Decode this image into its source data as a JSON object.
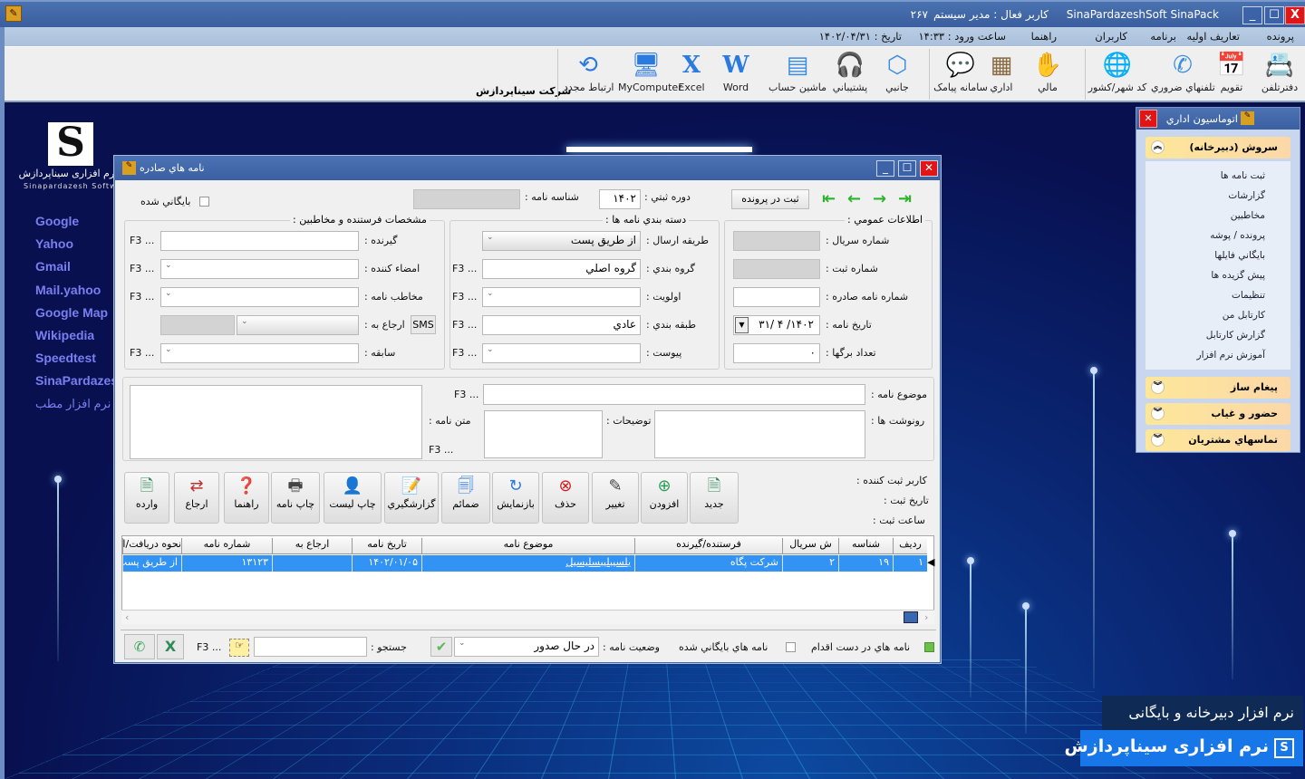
{
  "window": {
    "app_title": "SinaPardazeshSoft SinaPack",
    "active_user": "کاربر فعال : مدیر سیستم",
    "code": "۲۶۷",
    "minimize": "_",
    "maximize": "☐",
    "close": "X"
  },
  "menu": {
    "items": [
      "پرونده",
      "تعاریف اولیه",
      "برنامه",
      "کاربران",
      "راهنما"
    ],
    "login_time": "ساعت ورود : ۱۴:۳۳",
    "date": "تاریخ : ۱۴۰۲/۰۴/۳۱"
  },
  "toolbar": {
    "company": "شرکت سیناپردازش",
    "items": [
      {
        "label": "دفترتلفن",
        "icon": "contacts-icon",
        "glyph": "📇",
        "color": "#2a7ae0"
      },
      {
        "label": "تقویم",
        "icon": "calendar-icon",
        "glyph": "📅",
        "color": "#2a7ae0"
      },
      {
        "label": "تلفنهاي ضروري",
        "icon": "phone-icon",
        "glyph": "✆",
        "color": "#3b8de0"
      },
      {
        "label": "کد شهر/کشور",
        "icon": "globe-icon",
        "glyph": "🌐",
        "color": "#2a7ae0"
      },
      {
        "label": "مالي",
        "icon": "money-hand-icon",
        "glyph": "✋",
        "color": "#c0392b"
      },
      {
        "label": "اداري",
        "icon": "office-building-icon",
        "glyph": "▦",
        "color": "#8a6a40"
      },
      {
        "label": "سامانه پيامک",
        "icon": "sms-icon",
        "glyph": "💬",
        "color": "#5cb85c"
      },
      {
        "label": "جانبي",
        "icon": "box-icon",
        "glyph": "⬡",
        "color": "#3b8de0"
      },
      {
        "label": "پشتيباني",
        "icon": "headset-icon",
        "glyph": "🎧",
        "color": "#3b8de0"
      },
      {
        "label": "ماشين حساب",
        "icon": "calculator-icon",
        "glyph": "▤",
        "color": "#3b8de0"
      },
      {
        "label": "Word",
        "icon": "word-icon",
        "glyph": "W",
        "color": "#2a7ae0"
      },
      {
        "label": "Excel",
        "icon": "excel-icon",
        "glyph": "X",
        "color": "#2a7ae0"
      },
      {
        "label": "MyComputer",
        "icon": "computer-icon",
        "glyph": "🖥",
        "color": "#2a7ae0"
      },
      {
        "label": "ارتباط مجدد",
        "icon": "reconnect-icon",
        "glyph": "⟲",
        "color": "#2a7ae0"
      }
    ]
  },
  "desktop": {
    "logo_text": "نرم افزاری سیناپردازش",
    "logo_sub": "Sinapardazesh Software",
    "links": [
      "Google",
      "Yahoo",
      "Gmail",
      "Mail.yahoo",
      "Google Map",
      "Wikipedia",
      "Speedtest",
      "SinaPardazesh",
      "نرم افزار مطب"
    ],
    "banner_top": "نرم افزار دبیرخانه و بایگانی",
    "banner_bottom": "نرم افزاری سیناپردازش"
  },
  "side_panel": {
    "title": "اتوماسیون اداري",
    "groups": [
      {
        "label": "سروش (دبیرخانه)",
        "expanded": true,
        "items": [
          "ثبت نامه ها",
          "گزارشات",
          "مخاطبين",
          "پرونده / پوشه",
          "بايگاني فايلها",
          "پيش گزيده ها",
          "تنظيمات",
          "كارتابل من",
          "گزارش كارتابل",
          "آموزش نرم افزار"
        ]
      },
      {
        "label": "پیغام ساز",
        "expanded": false
      },
      {
        "label": "حضور و غیاب",
        "expanded": false
      },
      {
        "label": "تماسهاي مشتريان",
        "expanded": false
      }
    ]
  },
  "dialog": {
    "title": "نامه هاي صادره",
    "archived_label": "بايگاني شده",
    "letter_id_label": "شناسه نامه :",
    "letter_id": "",
    "period_label": "دوره ثبتي :",
    "period": "۱۴۰۲",
    "save_to_file": "ثبت در پرونده",
    "general": {
      "legend": "اطلاعات عمومي :",
      "serial_label": "شماره سريال :",
      "reg_no_label": "شماره ثبت :",
      "issued_no_label": "شماره نامه صادره :",
      "date_label": "تاريخ نامه :",
      "date": "۱۴۰۲/ ۴ /۳۱",
      "pages_label": "تعداد برگها :",
      "pages": "۰"
    },
    "category": {
      "legend": "دسته بندي نامه ها :",
      "send_method_label": "طريقه ارسال :",
      "send_method": "از طريق پست",
      "group_label": "گروه بندي :",
      "group": "گروه اصلي",
      "priority_label": "اولويت :",
      "priority": "",
      "class_label": "طبقه بندي :",
      "class": "عادي",
      "attachment_label": "پيوست :",
      "attachment": ""
    },
    "parties": {
      "legend": "مشخصات فرستنده و مخاطبين :",
      "receiver_label": "گيرنده :",
      "signer_label": "امضاء کننده :",
      "addressee_label": "مخاطب نامه :",
      "refer_label": "ارجاع به :",
      "sms": "SMS",
      "history_label": "سابقه :"
    },
    "f3": "F3 ...",
    "subject_label": "موضوع نامه :",
    "copies_label": "رونوشت ها :",
    "notes_label": "توضيحات :",
    "body_label": "متن نامه :",
    "reg_user_label": "کاربر ثبت کننده :",
    "reg_date_label": "تاريخ ثبت :",
    "reg_time_label": "ساعت ثبت :",
    "buttons": [
      {
        "label": "جديد",
        "icon": "new-document-icon",
        "glyph": "🗎",
        "color": "#2e8b57"
      },
      {
        "label": "افزودن",
        "icon": "add-icon",
        "glyph": "⊕",
        "color": "#2e9e5a"
      },
      {
        "label": "تغيير",
        "icon": "edit-icon",
        "glyph": "✎",
        "color": "#444"
      },
      {
        "label": "حذف",
        "icon": "delete-icon",
        "glyph": "⊗",
        "color": "#d02020"
      },
      {
        "label": "بازنمايش",
        "icon": "refresh-icon",
        "glyph": "↻",
        "color": "#2a7ae0"
      },
      {
        "label": "ضمائم",
        "icon": "attachments-icon",
        "glyph": "🗐",
        "color": "#2a7ae0"
      },
      {
        "label": "گزارشگيري",
        "icon": "report-icon",
        "glyph": "📝",
        "color": "#3b8de0"
      },
      {
        "label": "چاپ ليست",
        "icon": "print-list-icon",
        "glyph": "👤",
        "color": "#2a5aa0"
      },
      {
        "label": "چاپ نامه",
        "icon": "print-icon",
        "glyph": "🖶",
        "color": "#444"
      },
      {
        "label": "راهنما",
        "icon": "help-icon",
        "glyph": "❓",
        "color": "#2e8b57"
      },
      {
        "label": "ارجاع",
        "icon": "refer-icon",
        "glyph": "⇄",
        "color": "#c03030"
      },
      {
        "label": "وارده",
        "icon": "incoming-icon",
        "glyph": "🗎",
        "color": "#2e8b57"
      }
    ],
    "table": {
      "columns": [
        "رديف",
        "شناسه",
        "ش سريال",
        "فرستنده/گيرنده",
        "موضوع نامه",
        "تاريخ نامه",
        "ارجاع به",
        "شماره نامه",
        "نحوه دریافت/ارسال"
      ],
      "rows": [
        [
          "۱",
          "۱۹",
          "۲",
          "شرکت پگاه",
          "يلسيبليبسليسيل",
          "۱۴۰۲/۰۱/۰۵",
          "",
          "۱۳۱۲۳",
          "از طريق پست"
        ]
      ]
    },
    "footer": {
      "pending_label": "نامه هاي در دست اقدام",
      "pending_checked": true,
      "archived_label": "نامه هاي بايگاني شده",
      "archived_checked": false,
      "status_label": "وضعيت نامه :",
      "status": "در حال صدور",
      "search_label": "جستجو :",
      "search_value": ""
    }
  }
}
